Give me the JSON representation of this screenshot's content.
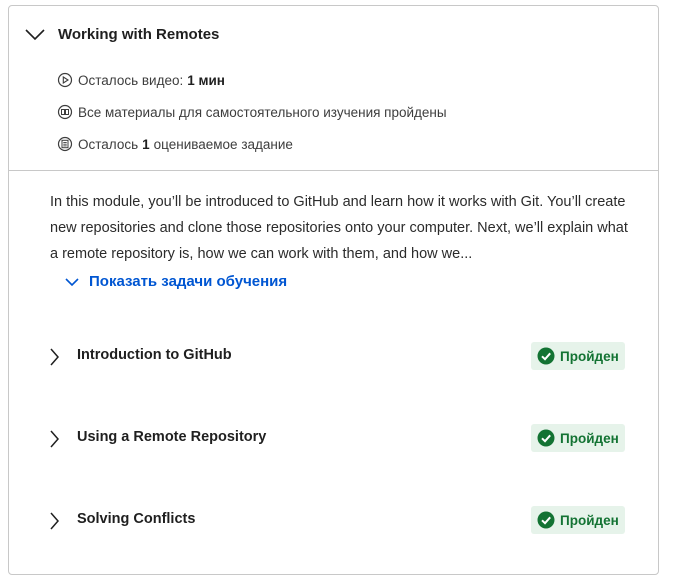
{
  "module": {
    "title": "Working with Remotes",
    "meta": {
      "video_prefix": "Осталось видео:",
      "video_value": "1 мин",
      "materials": "Все материалы для самостоятельного изучения пройдены",
      "graded_prefix": "Осталось",
      "graded_count": "1",
      "graded_suffix": "оцениваемое задание"
    },
    "description": "In this module, you’ll be introduced to GitHub and learn how it works with Git. You’ll create new repositories and clone those repositories onto your computer. Next, we’ll explain what a remote repository is, how we can work with them, and how we...",
    "show_goals_label": "Показать задачи обучения"
  },
  "lessons": [
    {
      "title": "Introduction to GitHub",
      "status": "Пройден"
    },
    {
      "title": "Using a Remote Repository",
      "status": "Пройден"
    },
    {
      "title": "Solving Conflicts",
      "status": "Пройден"
    }
  ],
  "colors": {
    "link": "#0056d2",
    "completed_bg": "#e6f3ea",
    "completed_fg": "#137333"
  },
  "icons": [
    "chevron-down-icon",
    "play-circle-icon",
    "reading-icon",
    "assignment-icon",
    "chevron-right-icon",
    "check-circle-icon"
  ]
}
